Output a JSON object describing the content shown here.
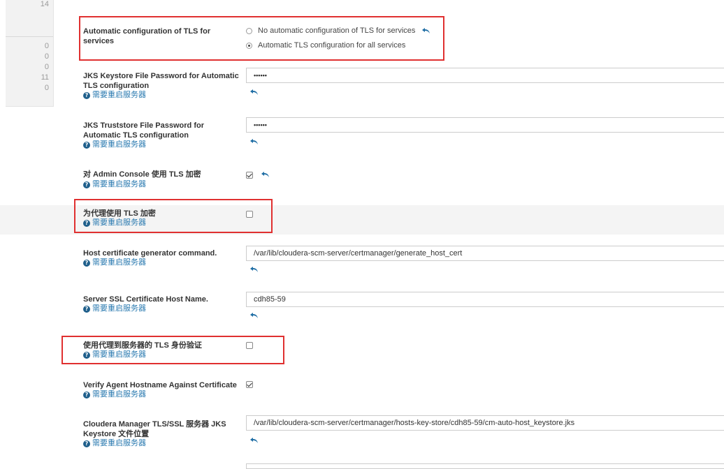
{
  "sidebar": {
    "top_partial": "14",
    "counts": [
      "0",
      "0",
      "0",
      "11",
      "0"
    ]
  },
  "restart_text": "需要重启服务器",
  "settings": {
    "auto_tls": {
      "label": "Automatic configuration of TLS for services",
      "options": [
        {
          "label": "No automatic configuration of TLS for services",
          "selected": false
        },
        {
          "label": "Automatic TLS configuration for all services",
          "selected": true
        }
      ]
    },
    "keystore_password": {
      "label": "JKS Keystore File Password for Automatic TLS configuration",
      "value": "••••••"
    },
    "truststore_password": {
      "label": "JKS Truststore File Password for Automatic TLS configuration",
      "value": "••••••"
    },
    "admin_console_tls": {
      "label": "对 Admin Console 使用 TLS 加密",
      "checked": true
    },
    "agent_tls": {
      "label": "为代理使用 TLS 加密",
      "checked": false
    },
    "host_cert_command": {
      "label": "Host certificate generator command.",
      "value": "/var/lib/cloudera-scm-server/certmanager/generate_host_cert"
    },
    "ssl_host_name": {
      "label": "Server SSL Certificate Host Name.",
      "value": "cdh85-59"
    },
    "agent_server_tls_auth": {
      "label": "使用代理到服务器的 TLS 身份验证",
      "checked": false
    },
    "verify_agent_hostname": {
      "label": "Verify Agent Hostname Against Certificate",
      "checked": true
    },
    "keystore_location": {
      "label": "Cloudera Manager TLS/SSL 服务器 JKS Keystore 文件位置",
      "value": "/var/lib/cloudera-scm-server/certmanager/hosts-key-store/cdh85-59/cm-auto-host_keystore.jks"
    }
  },
  "colors": {
    "highlight": "#e03030",
    "link": "#2a7ab0",
    "undo": "#1f6ea5"
  }
}
